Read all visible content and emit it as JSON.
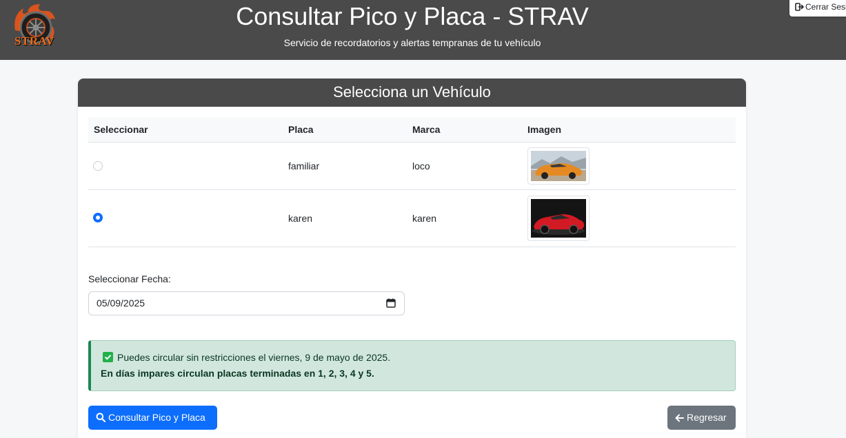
{
  "header": {
    "logo_text": "STRAV",
    "title": "Consultar Pico y Placa - STRAV",
    "subtitle": "Servicio de recordatorios y alertas tempranas de tu vehículo",
    "logout_label": "Cerrar Sesión"
  },
  "card": {
    "title": "Selecciona un Vehículo"
  },
  "table": {
    "columns": [
      "Seleccionar",
      "Placa",
      "Marca",
      "Imagen"
    ],
    "rows": [
      {
        "placa": "familiar",
        "marca": "loco",
        "selected": false,
        "image": "orange-sports-car"
      },
      {
        "placa": "karen",
        "marca": "karen",
        "selected": true,
        "image": "red-sports-car"
      }
    ]
  },
  "date": {
    "label": "Seleccionar Fecha:",
    "value": "05/09/2025"
  },
  "alert": {
    "message": "Puedes circular sin restricciones el viernes, 9 de mayo de 2025.",
    "rule": "En días impares circulan placas terminadas en 1, 2, 3, 4 y 5."
  },
  "actions": {
    "consult_label": "Consultar Pico y Placa",
    "back_label": "Regresar"
  },
  "colors": {
    "header_bg": "#4a4a4a",
    "primary": "#0d6efd",
    "secondary": "#6c757d",
    "success_bg": "#d1e7dd",
    "success_border": "#198754"
  }
}
